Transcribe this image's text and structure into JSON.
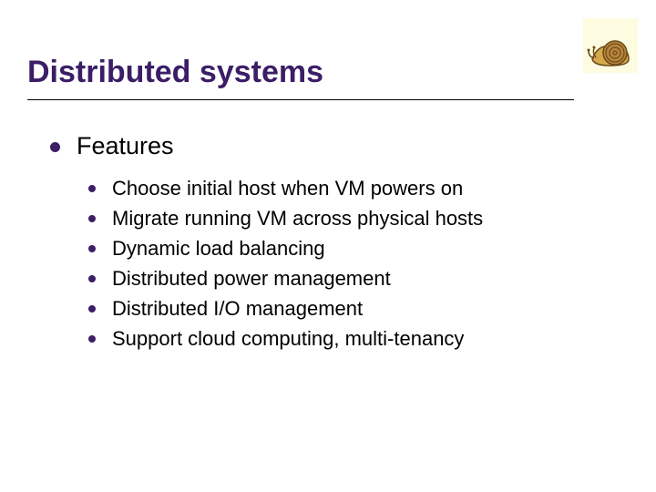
{
  "title": "Distributed systems",
  "heading": "Features",
  "items": [
    "Choose initial host when VM powers on",
    "Migrate running VM across physical hosts",
    "Dynamic load balancing",
    "Distributed power management",
    "Distributed I/O management",
    "Support cloud computing, multi-tenancy"
  ]
}
